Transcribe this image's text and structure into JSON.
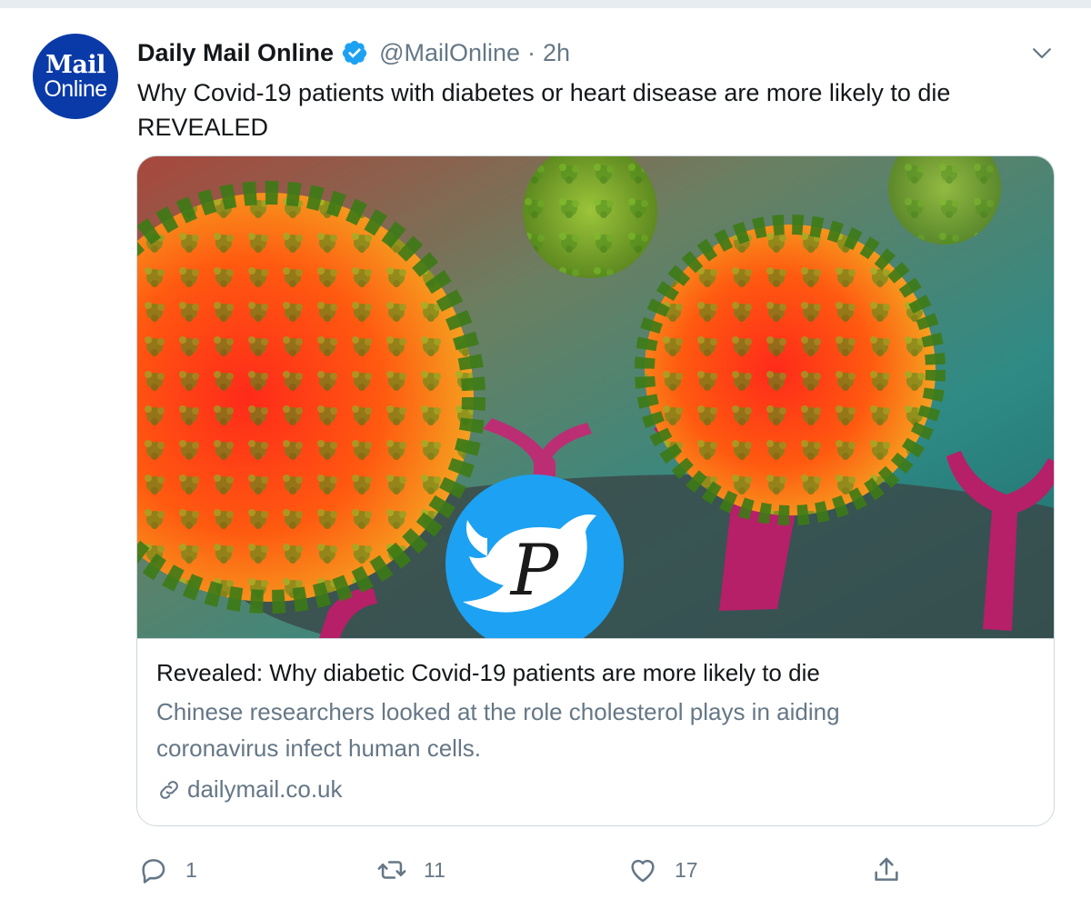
{
  "tweet": {
    "avatar": {
      "line1": "Mail",
      "line2": "Online",
      "icon": "mail-online-logo"
    },
    "author_name": "Daily Mail Online",
    "verified_icon": "verified-badge-icon",
    "handle": "@MailOnline",
    "separator": "·",
    "time": "2h",
    "menu_icon": "chevron-down-icon",
    "text": "Why Covid-19 patients with diabetes or heart disease are more likely to die REVEALED"
  },
  "card": {
    "image_icon": "coronavirus-image",
    "watermark_letter": "P",
    "title": "Revealed: Why diabetic Covid-19 patients are more likely to die",
    "description": "Chinese researchers looked at the role cholesterol plays in aiding coronavirus infect human cells.",
    "link_icon": "link-icon",
    "domain": "dailymail.co.uk"
  },
  "actions": {
    "reply": {
      "icon": "reply-icon",
      "count": "1"
    },
    "retweet": {
      "icon": "retweet-icon",
      "count": "11"
    },
    "like": {
      "icon": "heart-icon",
      "count": "17"
    },
    "share": {
      "icon": "share-icon"
    }
  },
  "colors": {
    "verified": "#1da1f2",
    "secondary_text": "#657786",
    "primary_text": "#14171a",
    "avatar_bg": "#0a3aa8",
    "border": "#ccd6dd"
  }
}
